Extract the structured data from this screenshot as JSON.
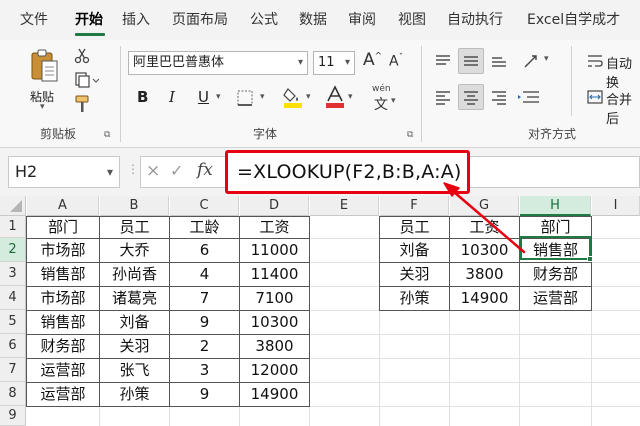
{
  "tabs": [
    "文件",
    "开始",
    "插入",
    "页面布局",
    "公式",
    "数据",
    "审阅",
    "视图",
    "自动执行",
    "Excel自学成才"
  ],
  "active_tab": "开始",
  "ribbon": {
    "clipboard": {
      "paste_label": "粘贴",
      "group_label": "剪贴板"
    },
    "font": {
      "font_name": "阿里巴巴普惠体",
      "font_size": "11",
      "grow": "A",
      "shrink": "A",
      "bold": "B",
      "italic": "I",
      "underline": "U",
      "color_letter": "A",
      "phonetic_top": "wén",
      "phonetic_bottom": "文",
      "group_label": "字体"
    },
    "alignment": {
      "wrap_label": "自动换",
      "merge_label": "合并后",
      "group_label": "对齐方式"
    }
  },
  "formula_bar": {
    "name_box": "H2",
    "formula": "=XLOOKUP(F2,B:B,A:A)",
    "fx": "fx",
    "cancel": "×",
    "confirm": "✓"
  },
  "columns": [
    "A",
    "B",
    "C",
    "D",
    "E",
    "F",
    "G",
    "H",
    "I"
  ],
  "selected_column": "H",
  "rows": [
    "1",
    "2",
    "3",
    "4",
    "5",
    "6",
    "7",
    "8",
    "9"
  ],
  "selected_row": "2",
  "table1": {
    "headers": [
      "部门",
      "员工",
      "工龄",
      "工资"
    ],
    "rows": [
      [
        "市场部",
        "大乔",
        "6",
        "11000"
      ],
      [
        "销售部",
        "孙尚香",
        "4",
        "11400"
      ],
      [
        "市场部",
        "诸葛亮",
        "7",
        "7100"
      ],
      [
        "销售部",
        "刘备",
        "9",
        "10300"
      ],
      [
        "财务部",
        "关羽",
        "2",
        "3800"
      ],
      [
        "运营部",
        "张飞",
        "3",
        "12000"
      ],
      [
        "运营部",
        "孙策",
        "9",
        "14900"
      ]
    ]
  },
  "table2": {
    "headers": [
      "员工",
      "工资",
      "部门"
    ],
    "rows": [
      [
        "刘备",
        "10300",
        "销售部"
      ],
      [
        "关羽",
        "3800",
        "财务部"
      ],
      [
        "孙策",
        "14900",
        "运营部"
      ]
    ]
  },
  "colors": {
    "accent_green": "#1f7a44",
    "annotation_red": "#e60012",
    "highlight_yellow": "#ffe000",
    "font_red": "#e03030"
  },
  "icons": [
    "paste-icon",
    "cut-icon",
    "copy-icon",
    "format-painter-icon",
    "fill-color-icon",
    "font-color-icon",
    "align-icon",
    "wrap-text-icon",
    "merge-icon",
    "annotation-arrow"
  ]
}
